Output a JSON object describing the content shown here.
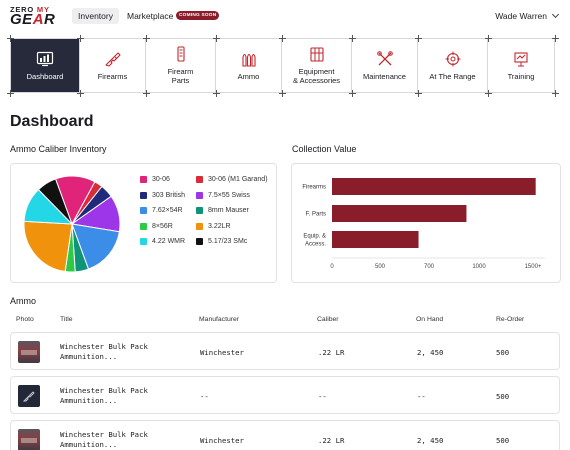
{
  "brand": {
    "line1_a": "ZERO ",
    "line1_b": "MY",
    "line2_a": "GE",
    "line2_b": "A",
    "line2_c": "R"
  },
  "topnav": {
    "inventory": "Inventory",
    "marketplace": "Marketplace",
    "badge": "COMING SOON",
    "user": "Wade Warren"
  },
  "categories": [
    {
      "label": "Dashboard",
      "icon": "dashboard-icon",
      "active": true
    },
    {
      "label": "Firearms",
      "icon": "rifle-icon"
    },
    {
      "label": "Firearm\nParts",
      "icon": "firearm-parts-icon"
    },
    {
      "label": "Ammo",
      "icon": "ammo-icon"
    },
    {
      "label": "Equipment\n& Accessories",
      "icon": "equipment-icon"
    },
    {
      "label": "Maintenance",
      "icon": "tools-icon"
    },
    {
      "label": "At The Range",
      "icon": "crosshair-icon"
    },
    {
      "label": "Training",
      "icon": "training-board-icon"
    }
  ],
  "page_title": "Dashboard",
  "ammo_caliber": {
    "title": "Ammo Caliber Inventory"
  },
  "collection": {
    "title": "Collection Value"
  },
  "chart_data": [
    {
      "type": "pie",
      "title": "Ammo Caliber Inventory",
      "legend_position": "right",
      "slices": [
        {
          "label": "30-06",
          "value": 12,
          "color": "#e0247a"
        },
        {
          "label": "30-06 (M1 Garand)",
          "value": 2.5,
          "color": "#d92b3a"
        },
        {
          "label": "303 British",
          "value": 4,
          "color": "#1f2a7a"
        },
        {
          "label": "7.5×55 Swiss",
          "value": 11,
          "color": "#9d35e8"
        },
        {
          "label": "7.62×54R",
          "value": 15,
          "color": "#3b8de8"
        },
        {
          "label": "8mm Mauser",
          "value": 4,
          "color": "#0f9478"
        },
        {
          "label": "8×56R",
          "value": 3,
          "color": "#2fc94a"
        },
        {
          "label": "3.22LR",
          "value": 21,
          "color": "#f0920c"
        },
        {
          "label": "4.22 WMR",
          "value": 10.5,
          "color": "#24d7e6"
        },
        {
          "label": "5.17/23 SMc",
          "value": 6,
          "color": "#111111"
        }
      ]
    },
    {
      "type": "bar",
      "orientation": "horizontal",
      "title": "Collection Value",
      "categories": [
        "Firearms",
        "F. Parts",
        "Equip. & Access."
      ],
      "values": [
        1530,
        1010,
        650
      ],
      "xlim": [
        0,
        1600
      ],
      "xticks": [
        "0",
        "500",
        "700",
        "1000",
        "1500+"
      ],
      "color": "#8a1d2a"
    }
  ],
  "ammo": {
    "title": "Ammo",
    "headers": [
      "Photo",
      "Title",
      "Manufacturer",
      "Caliber",
      "On Hand",
      "Re-Order"
    ],
    "rows": [
      {
        "thumb": "photo",
        "title1": "Winchester Bulk Pack",
        "title2": "Ammunition...",
        "manufacturer": "Winchester",
        "caliber": ".22 LR",
        "on_hand": "2, 450",
        "reorder": "500"
      },
      {
        "thumb": "icon",
        "title1": "Winchester Bulk Pack",
        "title2": "Ammunition...",
        "manufacturer": "--",
        "caliber": "--",
        "on_hand": "--",
        "reorder": "500"
      },
      {
        "thumb": "photo",
        "title1": "Winchester Bulk Pack",
        "title2": "Ammunition...",
        "manufacturer": "Winchester",
        "caliber": ".22 LR",
        "on_hand": "2, 450",
        "reorder": "500"
      }
    ]
  }
}
